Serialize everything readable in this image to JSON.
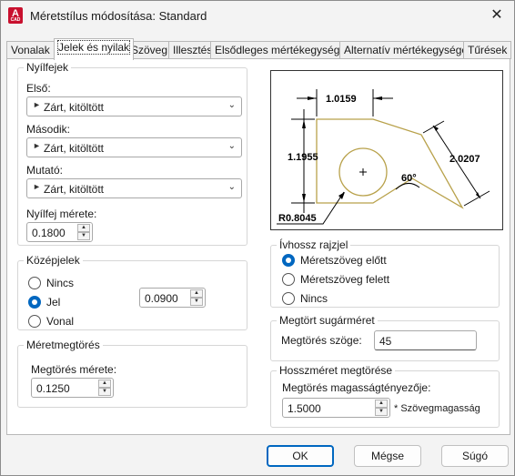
{
  "window": {
    "title": "Méretstílus módosítása: Standard",
    "app_icon_letter": "A",
    "app_icon_sub": "CAD"
  },
  "tabs": [
    {
      "label": "Vonalak"
    },
    {
      "label": "Jelek és nyilak",
      "active": true
    },
    {
      "label": "Szöveg"
    },
    {
      "label": "Illesztés"
    },
    {
      "label": "Elsődleges mértékegységek"
    },
    {
      "label": "Alternatív mértékegységek"
    },
    {
      "label": "Tűrések"
    }
  ],
  "arrowheads": {
    "title": "Nyílfejek",
    "first_label": "Első:",
    "first_value": "Zárt, kitöltött",
    "second_label": "Második:",
    "second_value": "Zárt, kitöltött",
    "leader_label": "Mutató:",
    "leader_value": "Zárt, kitöltött",
    "size_label": "Nyílfej mérete:",
    "size_value": "0.1800"
  },
  "center_marks": {
    "title": "Középjelek",
    "options": [
      "Nincs",
      "Jel",
      "Vonal"
    ],
    "selected": "Jel",
    "size_value": "0.0900"
  },
  "dimension_break": {
    "title": "Méretmegtörés",
    "size_label": "Megtörés mérete:",
    "size_value": "0.1250"
  },
  "preview": {
    "dim_top": "1.0159",
    "dim_left": "1.1955",
    "dim_diag": "2.0207",
    "angle": "60°",
    "radius": "R0.8045"
  },
  "arc_length_symbol": {
    "title": "Ívhossz rajzjel",
    "options": [
      "Méretszöveg előtt",
      "Méretszöveg felett",
      "Nincs"
    ],
    "selected": "Méretszöveg előtt"
  },
  "radius_jog": {
    "title": "Megtört sugárméret",
    "angle_label": "Megtörés szöge:",
    "angle_value": "45"
  },
  "linear_jog": {
    "title": "Hosszméret megtörése",
    "factor_label": "Megtörés magasságtényezője:",
    "factor_value": "1.5000",
    "suffix": "* Szövegmagasság"
  },
  "buttons": {
    "ok": "OK",
    "cancel": "Mégse",
    "help": "Súgó"
  },
  "colors": {
    "accent": "#0067c0",
    "preview_shape": "#b8a14a"
  }
}
